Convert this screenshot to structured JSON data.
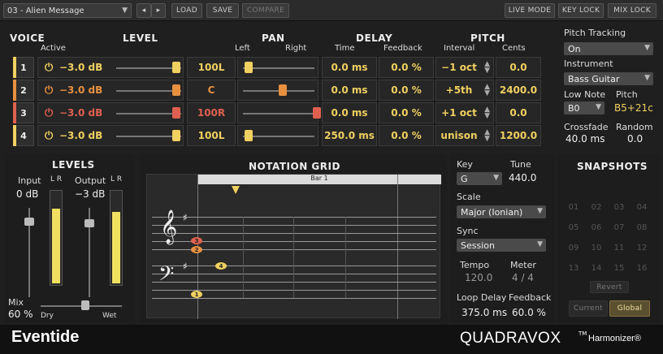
{
  "topbar": {
    "preset": "03 - Alien Message",
    "load": "LOAD",
    "save": "SAVE",
    "compare": "COMPARE",
    "live_mode": "LIVE MODE",
    "key_lock": "KEY LOCK",
    "mix_lock": "MIX LOCK"
  },
  "headers": {
    "voice": "VOICE",
    "active": "Active",
    "level": "LEVEL",
    "pan": "PAN",
    "pan_left": "Left",
    "pan_right": "Right",
    "delay": "DELAY",
    "time": "Time",
    "feedback": "Feedback",
    "pitch": "PITCH",
    "interval": "Interval",
    "cents": "Cents"
  },
  "voices": [
    {
      "num": "1",
      "level": "−3.0 dB",
      "pan": "100L",
      "time": "0.0 ms",
      "feedback": "0.0 %",
      "interval": "−1 oct",
      "cents": "0.0",
      "color": "#f0d060"
    },
    {
      "num": "2",
      "level": "−3.0 dB",
      "pan": "C",
      "time": "0.0 ms",
      "feedback": "0.0 %",
      "interval": "+5th",
      "cents": "2400.0",
      "color": "#e89040"
    },
    {
      "num": "3",
      "level": "−3.0 dB",
      "pan": "100R",
      "time": "0.0 ms",
      "feedback": "0.0 %",
      "interval": "+1 oct",
      "cents": "0.0",
      "color": "#e06050"
    },
    {
      "num": "4",
      "level": "−3.0 dB",
      "pan": "100L",
      "time": "250.0 ms",
      "feedback": "0.0 %",
      "interval": "unison",
      "cents": "1200.0",
      "color": "#f0d060"
    }
  ],
  "tracking": {
    "title": "Pitch Tracking",
    "mode": "On",
    "instrument_label": "Instrument",
    "instrument": "Bass Guitar",
    "low_note_label": "Low Note",
    "low_note": "B0",
    "pitch_label": "Pitch",
    "pitch": "B5+21c",
    "crossfade_label": "Crossfade",
    "crossfade": "40.0 ms",
    "random_label": "Random",
    "random": "0.0"
  },
  "levels": {
    "title": "LEVELS",
    "input_label": "Input",
    "input": "0 dB",
    "output_label": "Output",
    "output": "−3 dB",
    "lr": "L R",
    "mix_label": "Mix",
    "mix": "60 %",
    "dry": "Dry",
    "wet": "Wet"
  },
  "notation": {
    "title": "NOTATION GRID",
    "bar": "Bar 1",
    "notes": [
      "3",
      "2",
      "4",
      "1"
    ]
  },
  "key": {
    "key_label": "Key",
    "key": "G",
    "tune_label": "Tune",
    "tune": "440.0",
    "scale_label": "Scale",
    "scale": "Major (Ionian)",
    "sync_label": "Sync",
    "sync": "Session",
    "tempo_label": "Tempo",
    "tempo": "120.0",
    "meter_label": "Meter",
    "meter": "4 / 4",
    "loop_label": "Loop Delay",
    "loop": "375.0 ms",
    "fb_label": "Feedback",
    "fb": "60.0 %"
  },
  "snapshots": {
    "title": "SNAPSHOTS",
    "slots": [
      "01",
      "02",
      "03",
      "04",
      "05",
      "06",
      "07",
      "08",
      "09",
      "10",
      "11",
      "12",
      "13",
      "14",
      "15",
      "16"
    ],
    "revert": "Revert",
    "current": "Current",
    "global": "Global"
  },
  "footer": {
    "brand": "Eventide",
    "product": "QUADRAVOX",
    "tm": "TM",
    "harmonizer": "Harmonizer®"
  }
}
